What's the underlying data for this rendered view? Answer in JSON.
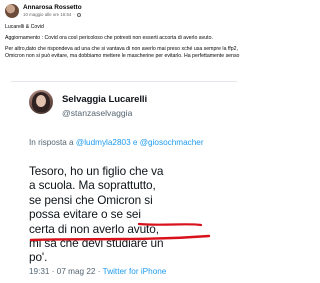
{
  "post": {
    "author": "Annarosa Rossetto",
    "date": "10 maggio alle ore 16:54",
    "separator": "·",
    "caption": [
      "Lucarelli & Covid",
      "Aggiornamento : Covid ora così pericoloso che potresti non esserti accorta di averlo avuto.",
      "Per altro,dato che rispondeva ad una che si vantava di non averlo mai preso xché usa sempre la ffp2, Omicron non si può evitare, ma dobbiamo mettere le mascherine per evitarlo. Ha perfettamente senso"
    ]
  },
  "tweet": {
    "name": "Selvaggia Lucarelli",
    "handle": "@stanzaselvaggia",
    "reply_prefix": "In risposta a",
    "reply_mentions": "@ludmyla2803 e @giosochmacher",
    "body_lines": [
      "Tesoro, ho un figlio che va",
      "a scuola. Ma soprattutto,",
      "se pensi che Omicron si",
      "possa evitare o se sei",
      "certa di non averlo avuto,",
      "mi sa che devi studiare un",
      "po'."
    ],
    "time": "19:31",
    "date": "07 mag 22",
    "source": "Twitter for iPhone",
    "underline_color": "#d8111b"
  }
}
